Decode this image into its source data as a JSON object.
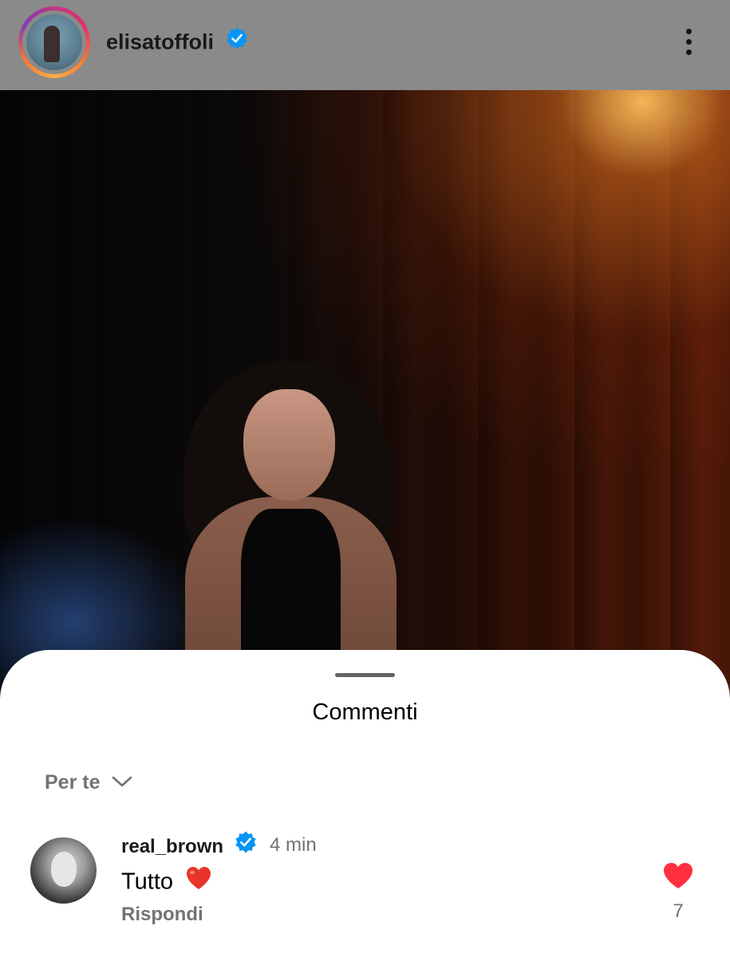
{
  "post_header": {
    "username": "elisatoffoli",
    "verified_icon": "verified-badge-icon",
    "menu_icon": "more-vertical-icon"
  },
  "comments_sheet": {
    "title": "Commenti",
    "filter": {
      "label": "Per te",
      "icon": "chevron-down-icon"
    },
    "comments": [
      {
        "username": "real_brown",
        "verified": true,
        "time": "4 min",
        "text": "Tutto",
        "emoji_icon": "red-heart-emoji",
        "reply_label": "Rispondi",
        "like_icon": "heart-filled-icon",
        "like_count": "7"
      }
    ]
  },
  "colors": {
    "verified_blue": "#0095f6",
    "like_red": "#ff3040",
    "secondary_text": "#737373"
  }
}
